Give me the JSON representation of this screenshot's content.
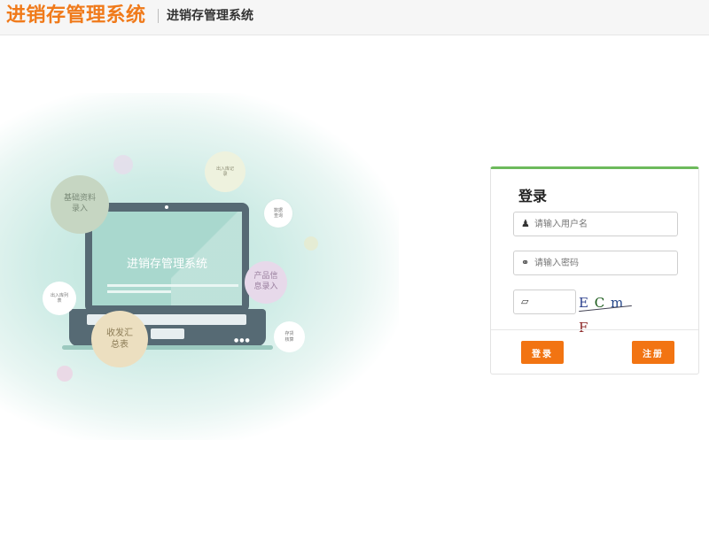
{
  "header": {
    "brand": "进销存管理系统",
    "subtitle": "进销存管理系统"
  },
  "hero": {
    "laptop_title": "进销存管理系统",
    "bubbles": {
      "basic_data": "基础资料录入",
      "io_records": "出入库记录",
      "data_query": "数据查询",
      "product_entry": "产品信息录入",
      "io_list": "出入库列表",
      "summary": "收发汇总表",
      "inventory": "存货核算"
    }
  },
  "login": {
    "title": "登录",
    "username_placeholder": "请输入用户名",
    "password_placeholder": "请输入密码",
    "captcha_text": [
      "E",
      "C",
      "m",
      "F"
    ],
    "login_label": "登录",
    "register_label": "注册"
  },
  "icons": {
    "user": "user-icon",
    "key": "key-icon",
    "lock": "unlock-icon"
  },
  "colors": {
    "brand": "#f07a1a",
    "button": "#f27412",
    "panel_accent": "#6dba5c"
  }
}
